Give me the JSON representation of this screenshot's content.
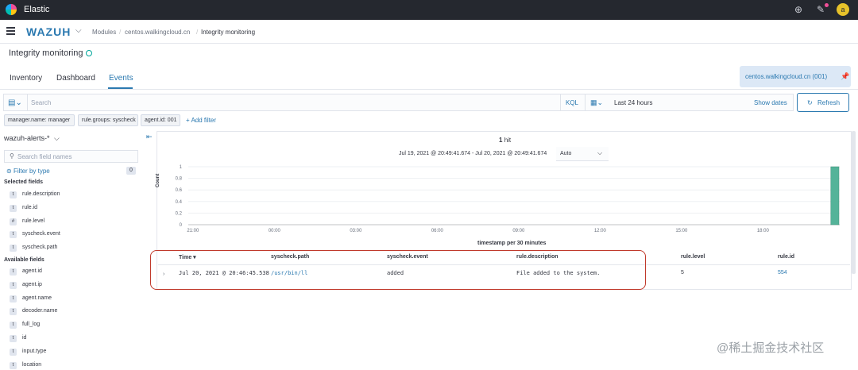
{
  "app": {
    "title": "Elastic",
    "avatar_letter": "a"
  },
  "header": {
    "brand": "WAZUH",
    "breadcrumbs": [
      "Modules",
      "centos.walkingcloud.cn",
      "Integrity monitoring"
    ]
  },
  "page": {
    "title": "Integrity monitoring",
    "tabs": [
      "Inventory",
      "Dashboard",
      "Events"
    ],
    "active_tab": "Events",
    "agent_label": "centos.walkingcloud.cn (001)"
  },
  "search": {
    "placeholder": "Search",
    "language": "KQL",
    "time_range": "Last 24 hours",
    "show_dates": "Show dates",
    "refresh": "Refresh"
  },
  "filters": {
    "pills": [
      "manager.name: manager",
      "rule.groups: syscheck",
      "agent.id: 001"
    ],
    "add_filter": "+ Add filter"
  },
  "sidebar": {
    "index_pattern": "wazuh-alerts-*",
    "search_placeholder": "Search field names",
    "filter_by_type": "Filter by type",
    "filter_count": "0",
    "selected_title": "Selected fields",
    "selected_fields": [
      {
        "type": "t",
        "name": "rule.description"
      },
      {
        "type": "t",
        "name": "rule.id"
      },
      {
        "type": "#",
        "name": "rule.level"
      },
      {
        "type": "t",
        "name": "syscheck.event"
      },
      {
        "type": "t",
        "name": "syscheck.path"
      }
    ],
    "available_title": "Available fields",
    "available_fields": [
      {
        "type": "t",
        "name": "agent.id"
      },
      {
        "type": "t",
        "name": "agent.ip"
      },
      {
        "type": "t",
        "name": "agent.name"
      },
      {
        "type": "t",
        "name": "decoder.name"
      },
      {
        "type": "t",
        "name": "full_log"
      },
      {
        "type": "t",
        "name": "id"
      },
      {
        "type": "t",
        "name": "input.type"
      },
      {
        "type": "t",
        "name": "location"
      }
    ]
  },
  "results": {
    "hit_count": "1",
    "hit_label": "hit",
    "time_range_text": "Jul 19, 2021 @ 20:49:41.674 - Jul 20, 2021 @ 20:49:41.674",
    "interval": "Auto"
  },
  "chart_data": {
    "type": "bar",
    "ylabel": "Count",
    "xlabel": "timestamp per 30 minutes",
    "ylim": [
      0,
      1
    ],
    "yticks": [
      "0",
      "0.2",
      "0.4",
      "0.6",
      "0.8",
      "1"
    ],
    "x_ticks": [
      "21:00",
      "00:00",
      "03:00",
      "06:00",
      "09:00",
      "12:00",
      "15:00",
      "18:00"
    ],
    "series": [
      {
        "values": [
          {
            "x": "2021-07-20 20:30",
            "y": 1
          }
        ]
      }
    ],
    "bar_color": "#54b399"
  },
  "table": {
    "headers": [
      "Time",
      "syscheck.path",
      "syscheck.event",
      "rule.description",
      "rule.level",
      "rule.id"
    ],
    "sort_indicator": "▾",
    "rows": [
      {
        "time": "Jul 20, 2021 @ 20:46:45.538",
        "syscheck_path": "/usr/bin/ll",
        "syscheck_event": "added",
        "rule_description": "File added to the system.",
        "rule_level": "5",
        "rule_id": "554"
      }
    ]
  },
  "watermark": "@稀土掘金技术社区"
}
